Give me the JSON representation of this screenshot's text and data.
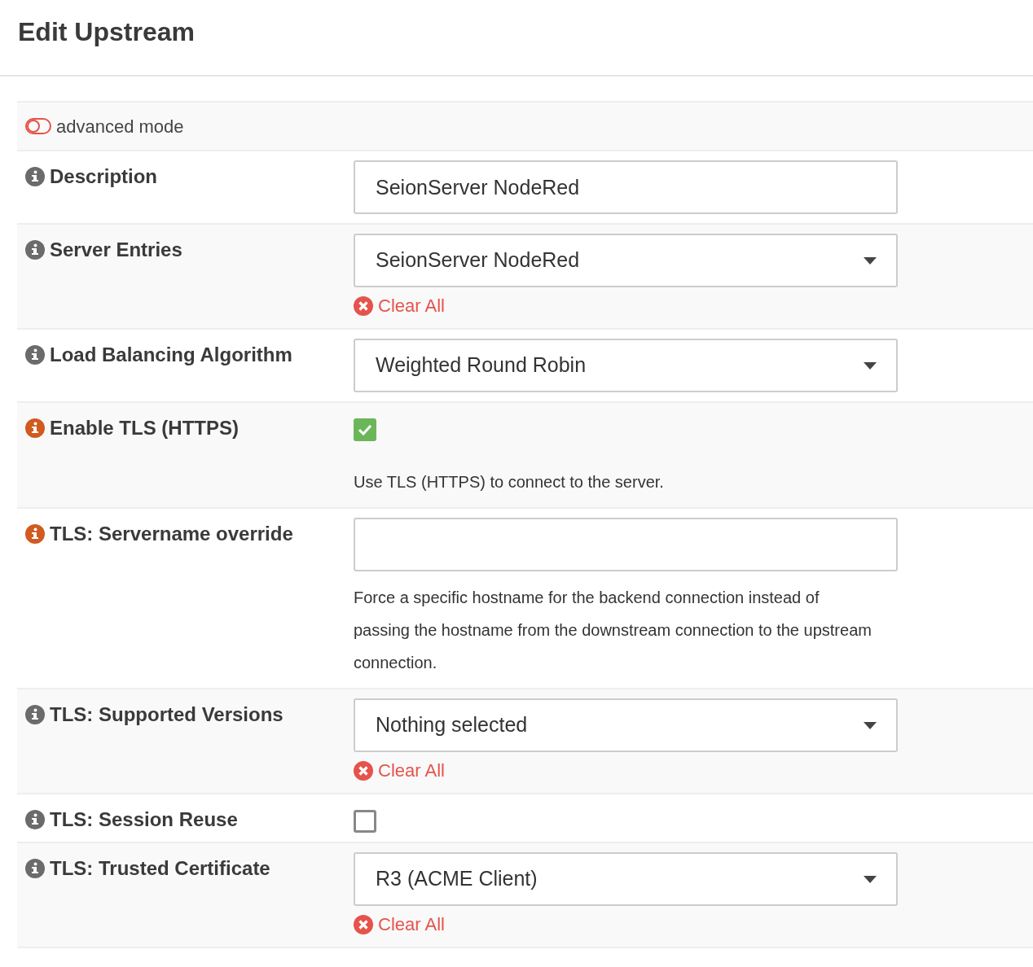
{
  "title": "Edit Upstream",
  "advanced_mode": {
    "label": "advanced mode",
    "on": false
  },
  "fields": [
    {
      "label": "Description",
      "color": "#6b6b6b",
      "kind": "text",
      "value": "SeionServer NodeRed"
    },
    {
      "label": "Server Entries",
      "color": "#6b6b6b",
      "kind": "select",
      "value": "SeionServer NodeRed",
      "clear": "Clear All"
    },
    {
      "label": "Load Balancing Algorithm",
      "color": "#6b6b6b",
      "kind": "select",
      "value": "Weighted Round Robin"
    },
    {
      "label": "Enable TLS (HTTPS)",
      "color": "#d15a1f",
      "kind": "checkbox",
      "checked": true,
      "help": "Use TLS (HTTPS) to connect to the server."
    },
    {
      "label": "TLS: Servername override",
      "color": "#d15a1f",
      "kind": "text",
      "help": "Force a specific hostname for the backend connection instead of passing the hostname from the downstream connection to the upstream connection."
    },
    {
      "label": "TLS: Supported Versions",
      "color": "#6b6b6b",
      "kind": "select",
      "value": "Nothing selected",
      "clear": "Clear All"
    },
    {
      "label": "TLS: Session Reuse",
      "color": "#6b6b6b",
      "kind": "checkbox",
      "checked": false
    },
    {
      "label": "TLS: Trusted Certificate",
      "color": "#6b6b6b",
      "kind": "select",
      "value": "R3 (ACME Client)",
      "clear": "Clear All"
    }
  ]
}
